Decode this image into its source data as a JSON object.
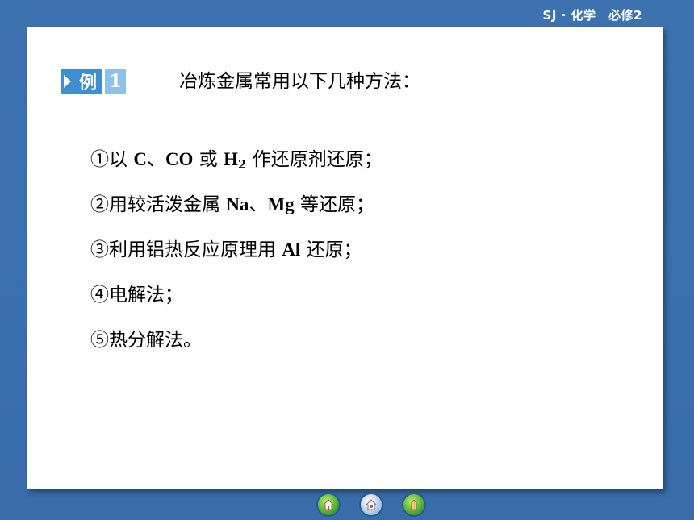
{
  "header": {
    "course_tag": "SJ · 化学　必修2"
  },
  "example": {
    "badge_label": "例",
    "badge_number": "1",
    "lead": "冶炼金属常用以下几种方法："
  },
  "items": [
    {
      "n": "①",
      "p1": "以 ",
      "lat1": "C",
      "p2": "、",
      "lat2": "CO",
      "p3": " 或 ",
      "lat3": "H",
      "sub": "2",
      "p4": " 作还原剂还原；"
    },
    {
      "n": "②",
      "p1": "用较活泼金属 ",
      "lat1": "Na",
      "p2": "、",
      "lat2": "Mg",
      "p3": " 等还原；"
    },
    {
      "n": "③",
      "p1": "利用铝热反应原理用 ",
      "lat1": "Al",
      "p2": " 还原；"
    },
    {
      "n": "④",
      "p1": "电解法；"
    },
    {
      "n": "⑤",
      "p1": "热分解法。"
    }
  ],
  "nav": {
    "buttons": [
      {
        "icon": "home-icon"
      },
      {
        "icon": "globe-icon"
      },
      {
        "icon": "hand-icon"
      }
    ]
  }
}
